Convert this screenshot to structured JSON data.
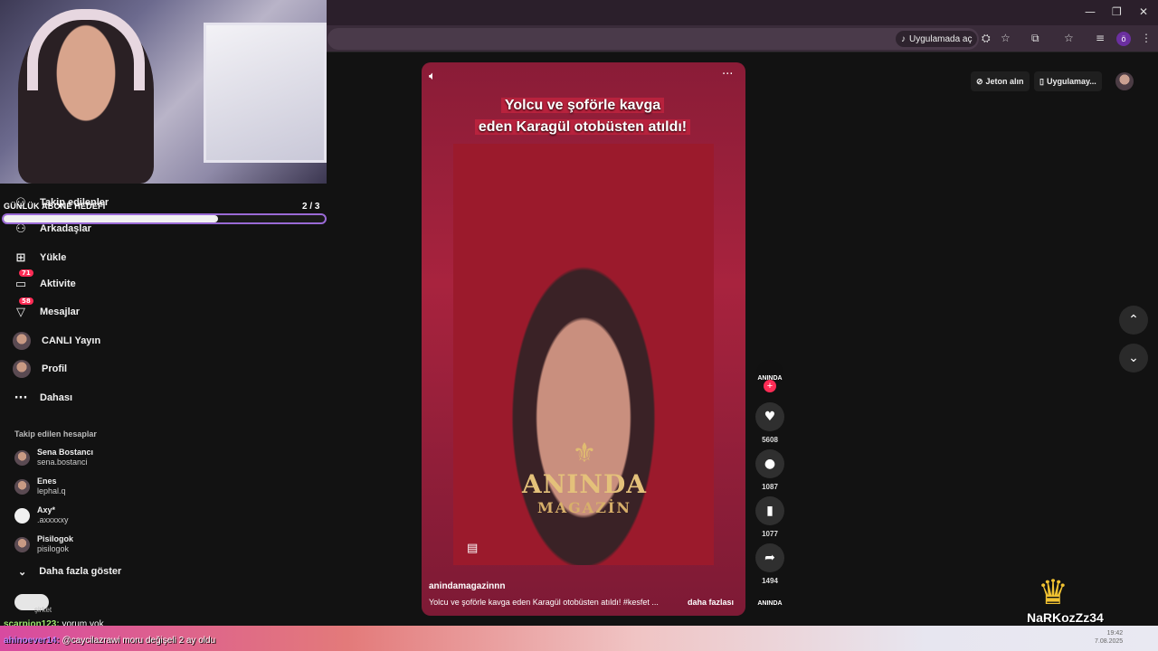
{
  "browser": {
    "open_in_app": "Uygulamada aç",
    "profile_initial": "ö",
    "window_controls": [
      "—",
      "❐",
      "✕"
    ]
  },
  "goal": {
    "label": "GÜNLÜK ABONE HEDEFİ",
    "count": "2 / 3",
    "progress": 0.667
  },
  "nav": {
    "items": [
      {
        "label": "Takip edilenler",
        "icon": "people-icon"
      },
      {
        "label": "Arkadaşlar",
        "icon": "friends-icon"
      },
      {
        "label": "Yükle",
        "icon": "upload-icon"
      },
      {
        "label": "Aktivite",
        "icon": "activity-icon",
        "badge": "71"
      },
      {
        "label": "Mesajlar",
        "icon": "messages-icon",
        "badge": "58"
      },
      {
        "label": "CANLI Yayın",
        "icon": "live-icon"
      },
      {
        "label": "Profil",
        "icon": "profile-icon"
      },
      {
        "label": "Dahası",
        "icon": "more-icon"
      }
    ]
  },
  "following": {
    "title": "Takip edilen hesaplar",
    "accounts": [
      {
        "name": "Sena Bostancı",
        "handle": "sena.bostanci"
      },
      {
        "name": "Enes",
        "handle": "lephal.q"
      },
      {
        "name": "Axy*",
        "handle": ".axxxxxy"
      },
      {
        "name": "Pisilogok",
        "handle": "pisilogok"
      }
    ],
    "show_more": "Daha fazla göster"
  },
  "video": {
    "caption_line1": "Yolcu ve şoförle kavga",
    "caption_line2": "eden Karagül otobüsten atıldı!",
    "logo_main": "ANINDA",
    "logo_sub": "MAGAZİN",
    "author": "anindamagazinnn",
    "description": "Yolcu ve şoförle kavga eden Karagül otobüsten atıldı! #kesfet ...",
    "more": "daha fazlası"
  },
  "actions": {
    "avatar_label": "ANINDA",
    "likes": "5608",
    "comments": "1087",
    "saves": "1077",
    "shares": "1494"
  },
  "top_right": {
    "coins": "Jeton alın",
    "app": "Uygulamay..."
  },
  "stream": {
    "streamer": "NaRKozZz34",
    "chat1_user": "scarpion123:",
    "chat1_text": " yorum yok",
    "chat2_user": "ahinoever14:",
    "chat2_text": " @caycilazrawi moru değişeli 2 ay oldu",
    "chat_label": "şirket"
  },
  "taskbar": {
    "time": "19:42",
    "date": "7.08.2025"
  }
}
